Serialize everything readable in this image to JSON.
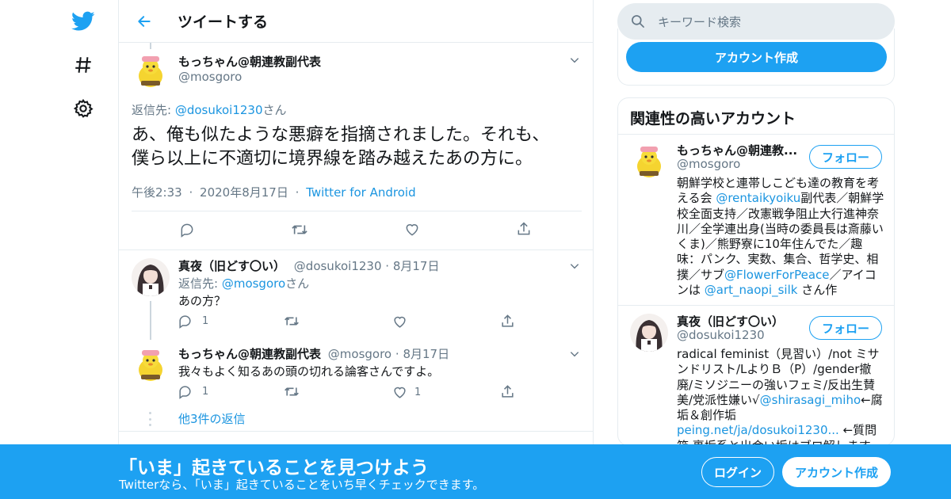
{
  "nav": {
    "icons": [
      "twitter-bird-icon",
      "hashtag-icon",
      "gear-icon"
    ]
  },
  "header": {
    "title": "ツイートする"
  },
  "main_tweet": {
    "name": "もっちゃん@朝連教副代表",
    "handle": "@mosgoro",
    "reply_to_prefix": "返信先: ",
    "reply_to_handle": "@dosukoi1230",
    "reply_to_suffix": "さん",
    "text_line1": "あ、俺も似たような悪癖を指摘されました。それも、",
    "text_line2": "僕ら以上に不適切に境界線を踏み越えたあの方に。",
    "time": "午後2:33",
    "date": "2020年8月17日",
    "source": "Twitter for Android",
    "sep": "·"
  },
  "replies": [
    {
      "name": "真夜（旧どす〇い）",
      "handle": "@dosukoi1230",
      "date": "8月17日",
      "reply_to_prefix": "返信先: ",
      "reply_to_handle": "@mosgoro",
      "reply_to_suffix": "さん",
      "text": "あの方？",
      "reply_count": "1",
      "like_count": ""
    },
    {
      "name": "もっちゃん@朝連教副代表",
      "handle": "@mosgoro",
      "date": "8月17日",
      "text": "我々もよく知るあの頭の切れる論客さんですよ。",
      "reply_count": "1",
      "like_count": "1"
    }
  ],
  "more_replies": "他3件の返信",
  "search": {
    "placeholder": "キーワード検索"
  },
  "signup_label": "アカウント作成",
  "related": {
    "title": "関連性の高いアカウント",
    "follow_label": "フォロー",
    "accounts": [
      {
        "name": "もっちゃん@朝連教...",
        "handle": "@mosgoro",
        "bio_parts": [
          {
            "t": "朝鮮学校と連帯しこども達の教育を考える会 "
          },
          {
            "t": "@rentaikyoiku",
            "link": true
          },
          {
            "t": "副代表／朝鮮学校全面支持／改憲戦争阻止大行進神奈川／全学連出身(当時の委員長は斎藤いくま)／熊野寮に10年住んでた／趣味：パンク、実数、集合、哲学史、相撲／サブ"
          },
          {
            "t": "@FlowerForPeace",
            "link": true
          },
          {
            "t": "／アイコンは "
          },
          {
            "t": "@art_naopi_silk",
            "link": true
          },
          {
            "t": " さん作"
          }
        ]
      },
      {
        "name": "真夜（旧どす〇い）",
        "handle": "@dosukoi1230",
        "bio_parts": [
          {
            "t": "radical feminist（見習い）/not ミサンドリスト/LよりＢ（P）/gender撤廃/ミソジニーの強いフェミ/反出生賛美/党派性嫌い√"
          },
          {
            "t": "@shirasagi_miho",
            "link": true
          },
          {
            "t": "←腐垢＆創作垢 "
          },
          {
            "t": "peing.net/ja/dosukoi1230...",
            "link": true
          },
          {
            "t": " ←質問箱 裏垢系と出会い垢はブロ解します"
          }
        ]
      }
    ]
  },
  "banner": {
    "title": "「いま」起きていることを見つけよう",
    "subtitle": "Twitterなら、「いま」起きていることをいち早くチェックできます。",
    "login": "ログイン",
    "signup": "アカウント作成"
  },
  "colors": {
    "accent": "#1da1f2",
    "link": "#1b95e0",
    "muted": "#657786"
  }
}
